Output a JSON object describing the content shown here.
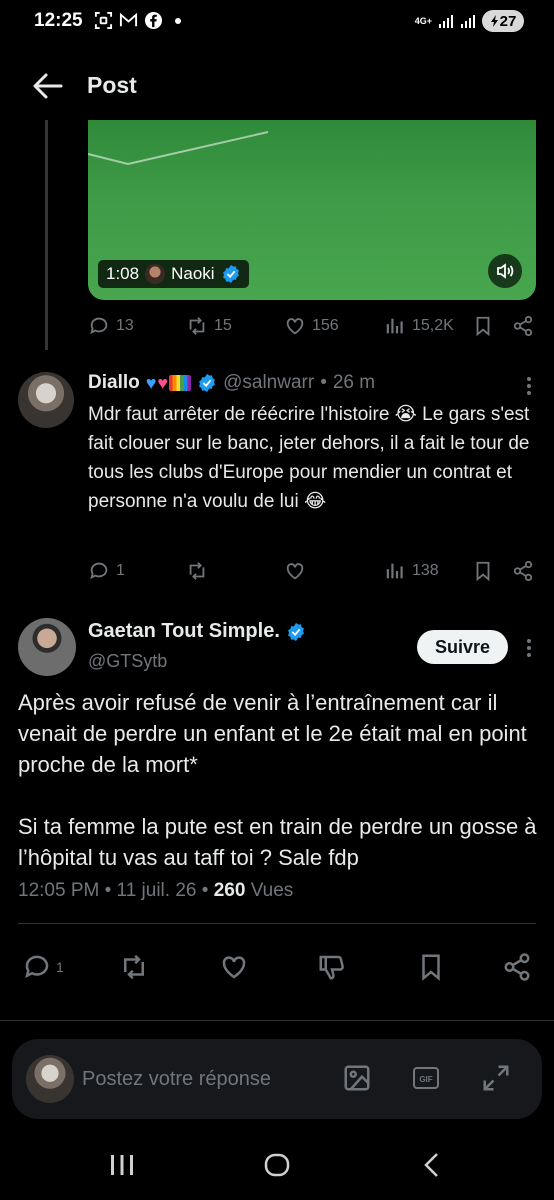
{
  "status_bar": {
    "time": "12:25",
    "network": "4G+",
    "battery": "27"
  },
  "header": {
    "title": "Post"
  },
  "quoted_video": {
    "duration": "1:08",
    "author": "Naoki"
  },
  "top_actions": {
    "replies": "13",
    "reposts": "15",
    "likes": "156",
    "views": "15,2K"
  },
  "reply": {
    "name": "Diallo",
    "handle": "@salnwarr",
    "time": "26 m",
    "text": "Mdr faut arrêter de réécrire l'histoire 😭 Le gars s'est fait clouer sur le banc, jeter dehors, il a fait le tour de tous les clubs d'Europe pour mendier un contrat et personne n'a voulu de lui 😂",
    "replies": "1",
    "views": "138"
  },
  "main_post": {
    "name": "Gaetan Tout Simple.",
    "handle": "@GTSytb",
    "follow_label": "Suivre",
    "text": "Après avoir refusé de venir à l’entraînement car il venait de perdre un enfant et le 2e était mal en point proche de la mort*\n\nSi ta femme la pute est en train de perdre un gosse à l’hôpital tu vas au taff toi ? Sale fdp",
    "time": "12:05 PM",
    "date": "11 juil. 26",
    "views_count": "260",
    "views_label": "Vues",
    "replies": "1"
  },
  "compose": {
    "placeholder": "Postez votre réponse"
  },
  "colors": {
    "background": "#000000",
    "text": "#e7e9ea",
    "muted": "#71767b",
    "verified": "#1d9bf0"
  }
}
